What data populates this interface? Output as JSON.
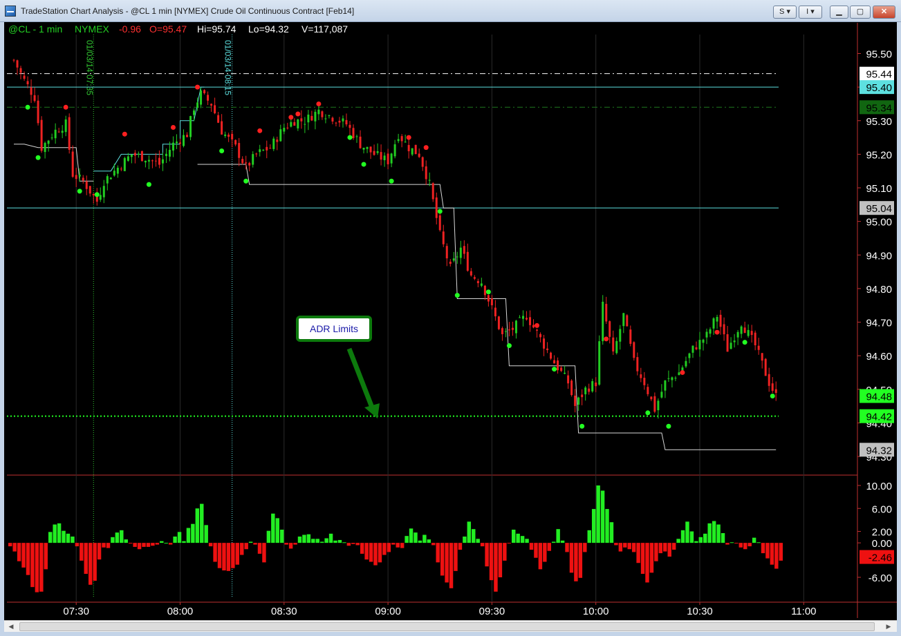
{
  "window": {
    "title": "TradeStation Chart Analysis - @CL 1 min [NYMEX] Crude Oil Continuous Contract [Feb14]",
    "buttons": {
      "s_menu": "S",
      "i_menu": "I"
    }
  },
  "status_line": {
    "symbol": "@CL - 1 min",
    "exchange": "NYMEX",
    "net_change": "-0.96",
    "open": "O=95.47",
    "high": "Hi=95.74",
    "low": "Lo=94.32",
    "volume": "V=117,087"
  },
  "colors": {
    "background": "#000000",
    "up_green": "#22cc22",
    "down_red": "#ee2222",
    "cyan": "#5de0e0",
    "status_green": "#23d023",
    "status_red": "#ff3030",
    "callout_border": "#0d7a0d"
  },
  "annotation": {
    "text": "ADR Limits"
  },
  "chart_data": {
    "type": "candlestick",
    "x_ticks": [
      "07:30",
      "08:00",
      "08:30",
      "09:00",
      "09:30",
      "10:00",
      "10:30",
      "11:00"
    ],
    "price_axis": {
      "ticks": [
        "95.50",
        "95.40",
        "95.30",
        "95.20",
        "95.10",
        "95.00",
        "94.90",
        "94.80",
        "94.70",
        "94.60",
        "94.50",
        "94.40",
        "94.30"
      ],
      "range": [
        94.3,
        95.55
      ]
    },
    "price_markers": [
      {
        "value": 95.44,
        "label": "95.44",
        "style": "dash-dot",
        "color": "#ffffff",
        "label_bg": "#ffffff",
        "label_color": "#000000"
      },
      {
        "value": 95.4,
        "label": "95.40",
        "style": "solid",
        "color": "#5de0e0",
        "label_bg": "#5de0e0",
        "label_color": "#000000"
      },
      {
        "value": 95.34,
        "label": "95.34",
        "style": "dash-dot",
        "color": "#1f7a1f",
        "label_bg": "#116611",
        "label_color": "#000000"
      },
      {
        "value": 95.04,
        "label": "95.04",
        "style": "solid",
        "color": "#5de0e0",
        "label_bg": "#c0c0c0",
        "label_color": "#000000"
      },
      {
        "value": 94.48,
        "label": "94.48",
        "style": "none",
        "color": "#22ff22",
        "label_bg": "#22ff22",
        "label_color": "#000000"
      },
      {
        "value": 94.42,
        "label": "94.42",
        "style": "dotted",
        "color": "#22ff22",
        "label_bg": "#22ff22",
        "label_color": "#000000"
      },
      {
        "value": 94.32,
        "label": "94.32",
        "style": "none",
        "color": "#c0c0c0",
        "label_bg": "#c0c0c0",
        "label_color": "#000000"
      }
    ],
    "session_markers": [
      {
        "time": "07:35",
        "label": "01/03/14 07:35",
        "color": "#33cc33"
      },
      {
        "time": "08:15",
        "label": "01/03/14 08:15",
        "color": "#5de0e0"
      }
    ],
    "close_path": [
      [
        "07:12",
        95.48
      ],
      [
        "07:15",
        95.42
      ],
      [
        "07:18",
        95.37
      ],
      [
        "07:20",
        95.22
      ],
      [
        "07:24",
        95.27
      ],
      [
        "07:27",
        95.29
      ],
      [
        "07:29",
        95.14
      ],
      [
        "07:32",
        95.12
      ],
      [
        "07:36",
        95.06
      ],
      [
        "07:38",
        95.12
      ],
      [
        "07:42",
        95.16
      ],
      [
        "07:46",
        95.2
      ],
      [
        "07:50",
        95.19
      ],
      [
        "07:54",
        95.17
      ],
      [
        "07:58",
        95.23
      ],
      [
        "08:02",
        95.26
      ],
      [
        "08:04",
        95.34
      ],
      [
        "08:06",
        95.38
      ],
      [
        "08:09",
        95.35
      ],
      [
        "08:12",
        95.27
      ],
      [
        "08:16",
        95.22
      ],
      [
        "08:19",
        95.16
      ],
      [
        "08:22",
        95.2
      ],
      [
        "08:26",
        95.22
      ],
      [
        "08:30",
        95.28
      ],
      [
        "08:33",
        95.3
      ],
      [
        "08:36",
        95.3
      ],
      [
        "08:40",
        95.33
      ],
      [
        "08:44",
        95.31
      ],
      [
        "08:48",
        95.29
      ],
      [
        "08:52",
        95.23
      ],
      [
        "08:56",
        95.2
      ],
      [
        "09:00",
        95.18
      ],
      [
        "09:03",
        95.26
      ],
      [
        "09:06",
        95.22
      ],
      [
        "09:09",
        95.2
      ],
      [
        "09:12",
        95.11
      ],
      [
        "09:15",
        94.96
      ],
      [
        "09:18",
        94.86
      ],
      [
        "09:21",
        94.92
      ],
      [
        "09:24",
        94.84
      ],
      [
        "09:27",
        94.82
      ],
      [
        "09:30",
        94.74
      ],
      [
        "09:33",
        94.66
      ],
      [
        "09:36",
        94.68
      ],
      [
        "09:40",
        94.72
      ],
      [
        "09:44",
        94.65
      ],
      [
        "09:48",
        94.58
      ],
      [
        "09:52",
        94.52
      ],
      [
        "09:54",
        94.45
      ],
      [
        "09:57",
        94.5
      ],
      [
        "10:00",
        94.52
      ],
      [
        "10:02",
        94.75
      ],
      [
        "10:05",
        94.6
      ],
      [
        "10:08",
        94.72
      ],
      [
        "10:11",
        94.58
      ],
      [
        "10:14",
        94.52
      ],
      [
        "10:17",
        94.44
      ],
      [
        "10:20",
        94.52
      ],
      [
        "10:24",
        94.55
      ],
      [
        "10:28",
        94.62
      ],
      [
        "10:32",
        94.66
      ],
      [
        "10:35",
        94.72
      ],
      [
        "10:38",
        94.62
      ],
      [
        "10:42",
        94.7
      ],
      [
        "10:46",
        94.63
      ],
      [
        "10:50",
        94.52
      ],
      [
        "10:52",
        94.48
      ]
    ],
    "stop_steps": [
      [
        "07:12",
        95.23
      ],
      [
        "07:15",
        95.23
      ],
      [
        "07:19",
        95.22
      ],
      [
        "07:30",
        95.22
      ],
      [
        "07:31",
        95.12
      ],
      [
        "07:35",
        95.12
      ]
    ],
    "cyan_steps": [
      [
        "07:35",
        95.15
      ],
      [
        "07:40",
        95.15
      ],
      [
        "07:43",
        95.2
      ],
      [
        "07:55",
        95.2
      ],
      [
        "07:55",
        95.23
      ],
      [
        "08:00",
        95.23
      ],
      [
        "08:00",
        95.3
      ],
      [
        "08:04",
        95.3
      ],
      [
        "08:06",
        95.4
      ],
      [
        "08:07",
        95.4
      ]
    ],
    "white_steps": [
      [
        "08:05",
        95.17
      ],
      [
        "08:19",
        95.17
      ],
      [
        "08:20",
        95.11
      ],
      [
        "09:15",
        95.11
      ],
      [
        "09:16",
        95.04
      ],
      [
        "09:19",
        95.04
      ],
      [
        "09:20",
        94.77
      ],
      [
        "09:34",
        94.77
      ],
      [
        "09:35",
        94.57
      ],
      [
        "09:54",
        94.57
      ],
      [
        "09:55",
        94.37
      ],
      [
        "10:19",
        94.37
      ],
      [
        "10:20",
        94.32
      ],
      [
        "10:52",
        94.32
      ]
    ],
    "dots": [
      {
        "time": "07:16",
        "price": 95.34,
        "color": "green"
      },
      {
        "time": "07:19",
        "price": 95.19,
        "color": "green"
      },
      {
        "time": "07:27",
        "price": 95.34,
        "color": "red"
      },
      {
        "time": "07:31",
        "price": 95.09,
        "color": "green"
      },
      {
        "time": "07:36",
        "price": 95.08,
        "color": "green"
      },
      {
        "time": "07:44",
        "price": 95.26,
        "color": "red"
      },
      {
        "time": "07:51",
        "price": 95.11,
        "color": "green"
      },
      {
        "time": "07:58",
        "price": 95.28,
        "color": "red"
      },
      {
        "time": "08:05",
        "price": 95.4,
        "color": "red"
      },
      {
        "time": "08:12",
        "price": 95.21,
        "color": "green"
      },
      {
        "time": "08:19",
        "price": 95.12,
        "color": "green"
      },
      {
        "time": "08:23",
        "price": 95.27,
        "color": "red"
      },
      {
        "time": "08:32",
        "price": 95.31,
        "color": "red"
      },
      {
        "time": "08:34",
        "price": 95.32,
        "color": "red"
      },
      {
        "time": "08:40",
        "price": 95.35,
        "color": "red"
      },
      {
        "time": "08:49",
        "price": 95.25,
        "color": "green"
      },
      {
        "time": "08:53",
        "price": 95.17,
        "color": "green"
      },
      {
        "time": "09:01",
        "price": 95.12,
        "color": "green"
      },
      {
        "time": "09:06",
        "price": 95.25,
        "color": "red"
      },
      {
        "time": "09:11",
        "price": 95.22,
        "color": "red"
      },
      {
        "time": "09:15",
        "price": 95.03,
        "color": "green"
      },
      {
        "time": "09:20",
        "price": 94.78,
        "color": "green"
      },
      {
        "time": "09:29",
        "price": 94.79,
        "color": "green"
      },
      {
        "time": "09:35",
        "price": 94.63,
        "color": "green"
      },
      {
        "time": "09:43",
        "price": 94.69,
        "color": "red"
      },
      {
        "time": "09:48",
        "price": 94.56,
        "color": "green"
      },
      {
        "time": "09:56",
        "price": 94.39,
        "color": "green"
      },
      {
        "time": "10:03",
        "price": 94.65,
        "color": "red"
      },
      {
        "time": "10:15",
        "price": 94.43,
        "color": "green"
      },
      {
        "time": "10:21",
        "price": 94.39,
        "color": "green"
      },
      {
        "time": "10:25",
        "price": 94.55,
        "color": "red"
      },
      {
        "time": "10:35",
        "price": 94.67,
        "color": "red"
      },
      {
        "time": "10:43",
        "price": 94.64,
        "color": "green"
      },
      {
        "time": "10:51",
        "price": 94.48,
        "color": "green"
      }
    ],
    "oscillator": {
      "ticks": [
        "10.00",
        "6.00",
        "2.00",
        "0.00",
        "-6.00"
      ],
      "range": [
        -8,
        10.8
      ],
      "last_label": "-2.46",
      "histogram": [
        -0.6,
        -1.5,
        -3.2,
        -4.3,
        -5.6,
        -7.7,
        -8.6,
        -8.5,
        -4.6,
        1.9,
        3.2,
        3.4,
        2.1,
        1.6,
        1.1,
        -0.6,
        -3.1,
        -5.4,
        -7.3,
        -6.6,
        -2.9,
        -0.8,
        -0.9,
        1.0,
        1.8,
        2.2,
        0.6,
        -0.1,
        -0.7,
        -1.1,
        -0.7,
        -0.7,
        -0.5,
        -0.3,
        0.3,
        0.0,
        -0.3,
        1.1,
        1.9,
        0.3,
        2.6,
        3.3,
        6.0,
        6.8,
        3.1,
        -0.6,
        -3.3,
        -4.4,
        -4.8,
        -4.9,
        -4.4,
        -3.8,
        -2.1,
        -1.1,
        0.2,
        -0.3,
        -1.9,
        -3.4,
        2.1,
        5.1,
        4.3,
        2.3,
        -0.3,
        -1.0,
        -0.3,
        1.1,
        1.4,
        1.5,
        0.7,
        0.7,
        0.2,
        0.8,
        1.6,
        0.4,
        0.5,
        0.1,
        -0.5,
        -0.2,
        -0.4,
        -1.9,
        -2.9,
        -3.3,
        -3.9,
        -3.4,
        -2.1,
        -1.6,
        -0.3,
        -0.8,
        -0.9,
        1.2,
        2.5,
        1.8,
        0.4,
        1.4,
        0.6,
        -0.4,
        -3.4,
        -5.7,
        -6.9,
        -7.9,
        -4.9,
        -1.2,
        1.1,
        3.7,
        2.4,
        0.7,
        -0.6,
        -4.1,
        -6.5,
        -8.5,
        -6.0,
        -3.1,
        -0.1,
        2.3,
        1.6,
        1.2,
        0.7,
        -1.2,
        -2.6,
        -4.6,
        -3.3,
        -1.4,
        0.2,
        2.4,
        0.4,
        -1.6,
        -5.2,
        -6.7,
        -6.1,
        -1.6,
        2.2,
        5.9,
        10.0,
        9.1,
        5.9,
        3.6,
        -0.4,
        -1.5,
        -0.8,
        -1.1,
        -1.6,
        -3.5,
        -5.4,
        -6.9,
        -5.2,
        -3.2,
        -1.8,
        -1.5,
        -2.4,
        -1.2,
        0.7,
        2.2,
        3.7,
        2.0,
        0.3,
        1.0,
        1.6,
        3.4,
        3.8,
        3.2,
        1.7,
        -0.3,
        0.1,
        -0.1,
        -0.8,
        -1.1,
        -0.6,
        0.9,
        0.1,
        -1.8,
        -2.7,
        -3.8,
        -4.5,
        -3.1
      ]
    }
  }
}
